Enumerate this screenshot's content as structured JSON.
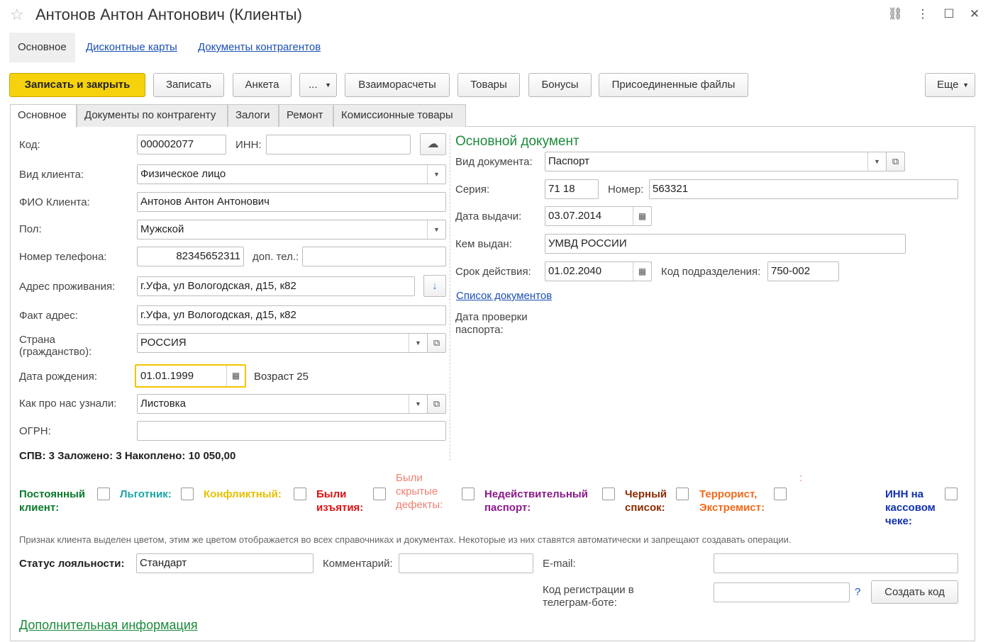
{
  "window": {
    "title": "Антонов Антон Антонович (Клиенты)",
    "link_icon": "⛓",
    "more_icon": "⋮",
    "max_icon": "☐",
    "close_icon": "✕"
  },
  "nav": {
    "main": "Основное",
    "discount_cards": "Дисконтные карты",
    "counterparty_docs": "Документы контрагентов"
  },
  "toolbar": {
    "save_close": "Записать и закрыть",
    "save": "Записать",
    "survey": "Анкета",
    "dots": "...",
    "settlements": "Взаиморасчеты",
    "goods": "Товары",
    "bonuses": "Бонусы",
    "attached_files": "Присоединенные файлы",
    "more": "Еще"
  },
  "tabs": [
    "Основное",
    "Документы по контрагенту",
    "Залоги",
    "Ремонт",
    "Комиссионные товары"
  ],
  "form": {
    "code_label": "Код:",
    "code_value": "000002077",
    "inn_label": "ИНН:",
    "inn_value": "",
    "client_type_label": "Вид клиента:",
    "client_type_value": "Физическое лицо",
    "fio_label": "ФИО Клиента:",
    "fio_value": "Антонов Антон Антонович",
    "gender_label": "Пол:",
    "gender_value": "Мужской",
    "phone_label": "Номер телефона:",
    "phone_value": "82345652311",
    "extra_phone_label": "доп. тел.:",
    "extra_phone_value": "",
    "address_label": "Адрес проживания:",
    "address_value": "г.Уфа, ул Вологодская, д15,  к82",
    "fact_address_label": "Факт адрес:",
    "fact_address_value": "г.Уфа, ул Вологодская, д15,  к82",
    "country_label_1": "Страна",
    "country_label_2": "(гражданство):",
    "country_value": "РОССИЯ",
    "birth_label": "Дата рождения:",
    "birth_value": "01.01.1999",
    "age_text": "Возраст 25",
    "source_label": "Как про нас узнали:",
    "source_value": "Листовка",
    "ogrn_label": "ОГРН:",
    "ogrn_value": "",
    "summary": "СПВ: 3 Заложено: 3 Накоплено: 10 050,00"
  },
  "document": {
    "header": "Основной документ",
    "type_label": "Вид документа:",
    "type_value": "Паспорт",
    "series_label": "Серия:",
    "series_value": "71 18",
    "number_label": "Номер:",
    "number_value": "563321",
    "issue_date_label": "Дата выдачи:",
    "issue_date_value": "03.07.2014",
    "issued_by_label": "Кем выдан:",
    "issued_by_value": "УМВД РОССИИ",
    "valid_label": "Срок действия:",
    "valid_value": "01.02.2040",
    "dept_code_label": "Код подразделения:",
    "dept_code_value": "750-002",
    "docs_list_link": "Список документов",
    "check_date_label_1": "Дата проверки",
    "check_date_label_2": "паспорта:"
  },
  "flags": {
    "permanent_1": "Постоянный",
    "permanent_2": "клиент:",
    "privileged": "Льготник:",
    "conflict": "Конфликтный:",
    "seized_1": "Были",
    "seized_2": "изъятия:",
    "defects_1": "Были",
    "defects_2": "скрытые",
    "defects_3": "дефекты:",
    "invalid_pass_1": "Недействительный",
    "invalid_pass_2": "паспорт:",
    "blacklist_1": "Черный",
    "blacklist_2": "список:",
    "terrorist_1": "Террорист,",
    "terrorist_2": "Экстремист:",
    "colon": ":",
    "inn_check_1": "ИНН на",
    "inn_check_2": "кассовом",
    "inn_check_3": "чеке:",
    "colors": {
      "permanent": "#0a7a2a",
      "privileged": "#1aa6a6",
      "conflict": "#e6c000",
      "seized": "#e01010",
      "defects": "#f08070",
      "invalid": "#8a1a8a",
      "blacklist": "#8b2a00",
      "terrorist": "#f06a1a",
      "inn": "#1030b0"
    }
  },
  "hint": "Признак клиента выделен цветом, этим же цветом отображается во всех справочниках и документах. Некоторые из них ставятся автоматически и запрещают создавать операции.",
  "loyalty": {
    "label": "Статус лояльности:",
    "value": "Стандарт",
    "comment_label": "Комментарий:",
    "comment_value": "",
    "email_label": "E-mail:",
    "email_value": "",
    "telegram_label_1": "Код регистрации в",
    "telegram_label_2": "телеграм-боте:",
    "telegram_value": "",
    "help": "?",
    "create_code": "Создать код"
  },
  "extra_link": "Дополнительная информация"
}
